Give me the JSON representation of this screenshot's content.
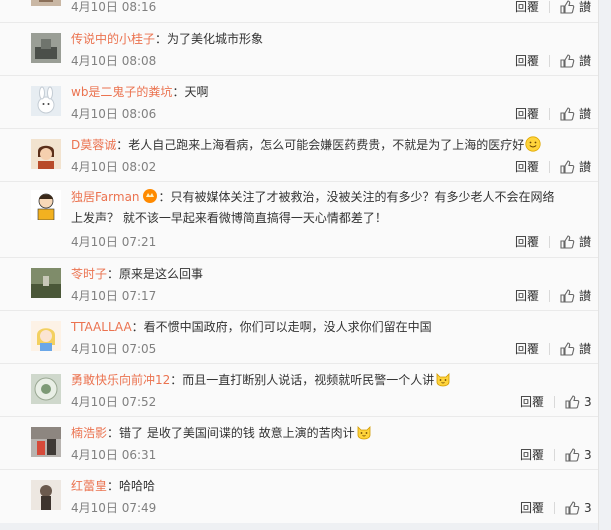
{
  "comments": [
    {
      "user": "",
      "text": "",
      "date": "4月10日 08:16",
      "reply": "回覆",
      "like": "讃"
    },
    {
      "user": "传说中的小桂子",
      "text": "：为了美化城市形象",
      "date": "4月10日 08:08",
      "reply": "回覆",
      "like": "讃"
    },
    {
      "user": "wb是二鬼子的粪坑",
      "text": "：天啊",
      "date": "4月10日 08:06",
      "reply": "回覆",
      "like": "讃"
    },
    {
      "user": "D莫蓉诚",
      "text": "：老人自己跑来上海看病，怎么可能会嫌医药费贵，不就是为了上海的医疗好",
      "date": "4月10日 08:02",
      "reply": "回覆",
      "like": "讃"
    },
    {
      "user": "独居Farman",
      "text": "：只有被媒体关注了才被救治，没被关注的有多少？有多少老人不会在网络上发声？ 就不该一早起来看微博简直搞得一天心情都差了！",
      "date": "4月10日 07:21",
      "reply": "回覆",
      "like": "讃"
    },
    {
      "user": "苓时子",
      "text": "：原来是这么回事",
      "date": "4月10日 07:17",
      "reply": "回覆",
      "like": "讃"
    },
    {
      "user": "TTAALLAA",
      "text": "：看不惯中国政府，你们可以走啊，没人求你们留在中国",
      "date": "4月10日 07:05",
      "reply": "回覆",
      "like": "讃"
    },
    {
      "user": "勇敢快乐向前冲12",
      "text": "：而且一直打断别人说话，视频就听民警一个人讲",
      "date": "4月10日 07:52",
      "reply": "回覆",
      "like": "3"
    },
    {
      "user": "楠浩影",
      "text": "：错了 是收了美国间谍的钱 故意上演的苦肉计",
      "date": "4月10日 06:31",
      "reply": "回覆",
      "like": "3"
    },
    {
      "user": "红蕾皇",
      "text": "：哈哈哈",
      "date": "4月10日 07:49",
      "reply": "回覆",
      "like": "3"
    }
  ]
}
